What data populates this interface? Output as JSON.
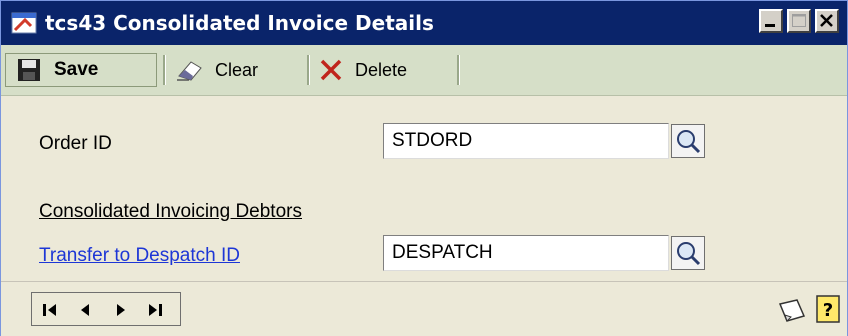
{
  "window": {
    "title": "tcs43 Consolidated Invoice Details"
  },
  "toolbar": {
    "save_label": "Save",
    "clear_label": "Clear",
    "delete_label": "Delete"
  },
  "form": {
    "order_id_label": "Order ID",
    "order_id_value": "STDORD",
    "section_label": "Consolidated Invoicing Debtors",
    "despatch_label": "Transfer to Despatch ID",
    "despatch_value": "DESPATCH"
  },
  "icons": {
    "title": "window-icon",
    "save": "save-icon",
    "clear": "eraser-icon",
    "delete": "delete-x-icon",
    "lookup": "magnifier-icon",
    "nav_first": "first-record-icon",
    "nav_prev": "previous-record-icon",
    "nav_next": "next-record-icon",
    "nav_last": "last-record-icon",
    "note": "note-icon",
    "help": "help-icon"
  },
  "colors": {
    "titlebar": "#0a246a",
    "toolbar": "#d6dfc8",
    "link": "#1d36d6"
  }
}
